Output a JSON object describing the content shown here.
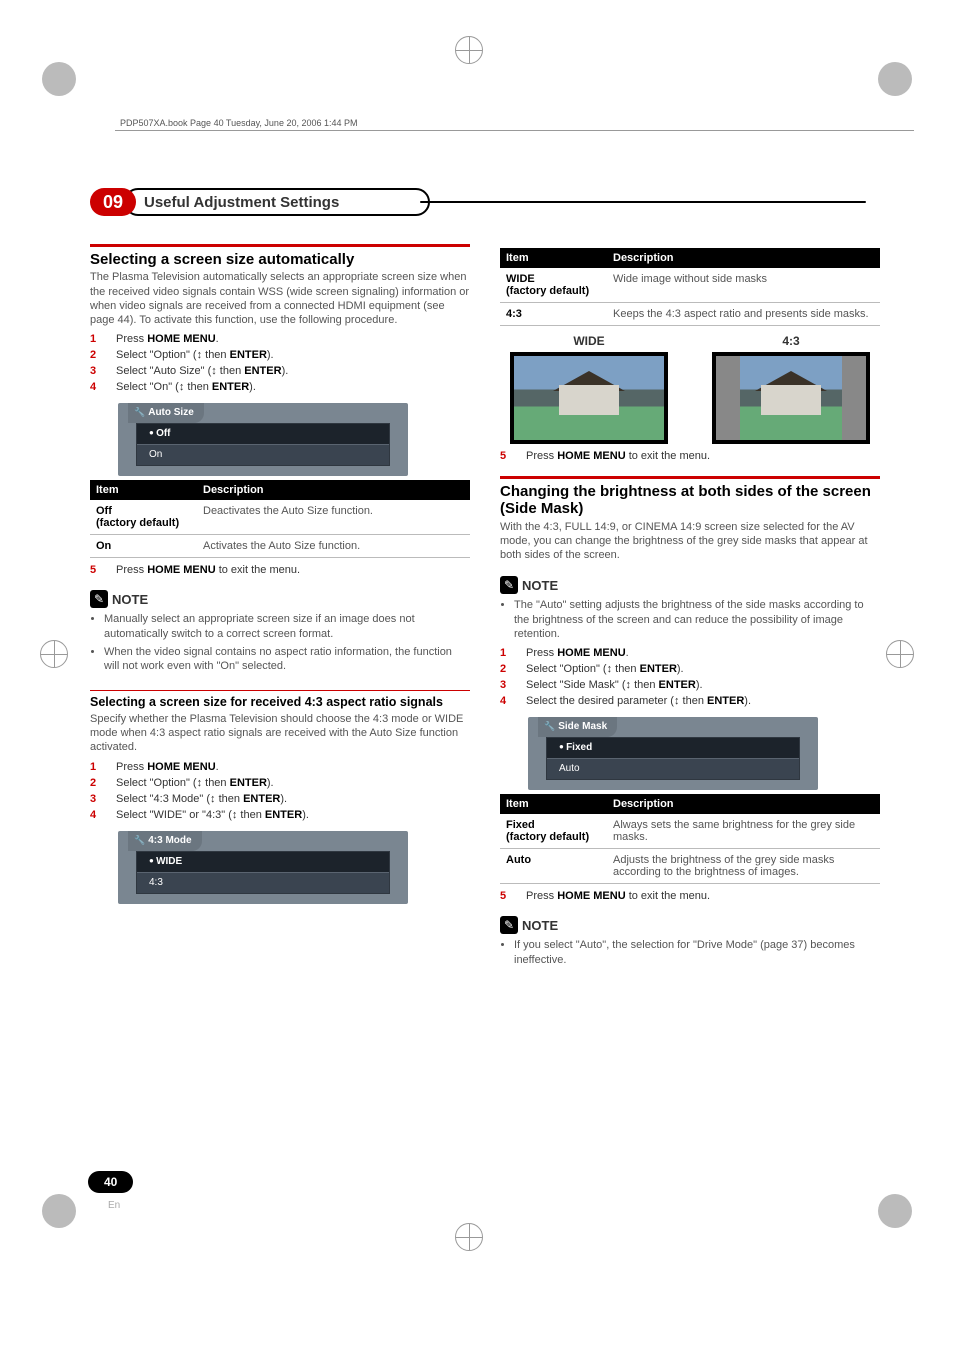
{
  "header_line": "PDP507XA.book  Page 40  Tuesday, June 20, 2006  1:44 PM",
  "chapter": {
    "number": "09",
    "title": "Useful Adjustment Settings"
  },
  "left": {
    "sec1": {
      "title": "Selecting a screen size automatically",
      "intro": "The Plasma Television automatically selects an appropriate screen size when the received video signals contain WSS (wide screen signaling) information or when video signals are received from a connected HDMI equipment (see page 44). To activate this function, use the following procedure.",
      "steps": {
        "s1": "Press ",
        "s1b": "HOME MENU",
        "s1c": ".",
        "s2": "Select \"Option\" (",
        "s2b": "ENTER",
        "s2c": ").",
        "s3": "Select \"Auto Size\" (",
        "s3b": "ENTER",
        "s3c": ").",
        "s4": "Select \"On\" (",
        "s4b": "ENTER",
        "s4c": ")."
      },
      "menu": {
        "tab": "Auto Size",
        "r1": "Off",
        "r2": "On"
      },
      "table": {
        "h_item": "Item",
        "h_desc": "Description",
        "r1k": "Off",
        "r1d": "(factory default)",
        "r1v": "Deactivates the Auto Size function.",
        "r2k": "On",
        "r2v": "Activates the Auto Size function."
      },
      "step5": "Press ",
      "step5b": "HOME MENU",
      "step5c": " to exit the menu.",
      "note_label": "NOTE",
      "note1": "Manually select an appropriate screen size if an image does not automatically switch to a correct screen format.",
      "note2": "When the video signal contains no aspect ratio information, the function will not work even with \"On\" selected."
    },
    "sec2": {
      "title": "Selecting a screen size for received 4:3 aspect ratio signals",
      "intro": "Specify whether the Plasma Television should choose the 4:3 mode or WIDE mode when 4:3 aspect ratio signals are received with the Auto Size function activated.",
      "steps": {
        "s1": "Press ",
        "s1b": "HOME MENU",
        "s1c": ".",
        "s2": "Select \"Option\" (",
        "s2b": "ENTER",
        "s2c": ").",
        "s3": "Select \"4:3 Mode\" (",
        "s3b": "ENTER",
        "s3c": ").",
        "s4": "Select \"WIDE\" or \"4:3\" (",
        "s4b": "ENTER",
        "s4c": ")."
      },
      "menu": {
        "tab": "4:3 Mode",
        "r1": "WIDE",
        "r2": "4:3"
      }
    }
  },
  "right": {
    "table1": {
      "h_item": "Item",
      "h_desc": "Description",
      "r1k": "WIDE",
      "r1d": "(factory default)",
      "r1v": "Wide image without side masks",
      "r2k": "4:3",
      "r2v": "Keeps the 4:3 aspect ratio and presents side masks."
    },
    "thumb_wide": "WIDE",
    "thumb_43": "4:3",
    "step5": "Press ",
    "step5b": "HOME MENU",
    "step5c": " to exit the menu.",
    "sec2": {
      "title": "Changing the brightness at both sides of the screen (Side Mask)",
      "intro": "With the 4:3, FULL 14:9, or CINEMA 14:9 screen size selected for the AV mode, you can change the brightness of the grey side masks that appear at both sides of the screen.",
      "note_label": "NOTE",
      "note1": "The \"Auto\" setting adjusts the brightness of the side masks according to the brightness of the screen and can reduce the possibility of image retention.",
      "steps": {
        "s1": "Press ",
        "s1b": "HOME MENU",
        "s1c": ".",
        "s2": "Select \"Option\" (",
        "s2b": "ENTER",
        "s2c": ").",
        "s3": "Select \"Side Mask\" (",
        "s3b": "ENTER",
        "s3c": ").",
        "s4": "Select the desired parameter (",
        "s4b": "ENTER",
        "s4c": ")."
      },
      "menu": {
        "tab": "Side Mask",
        "r1": "Fixed",
        "r2": "Auto"
      },
      "table": {
        "h_item": "Item",
        "h_desc": "Description",
        "r1k": "Fixed",
        "r1d": "(factory default)",
        "r1v": "Always sets the same brightness for the grey side masks.",
        "r2k": "Auto",
        "r2v": "Adjusts the brightness of the grey side masks according to the brightness of images."
      },
      "step5": "Press ",
      "step5b": "HOME MENU",
      "step5c": " to exit the menu.",
      "note2_label": "NOTE",
      "note2": "If you select \"Auto\", the selection for \"Drive Mode\" (page 37) becomes ineffective."
    }
  },
  "updown": "↕",
  "then": " then ",
  "page_number": "40",
  "page_lang": "En"
}
